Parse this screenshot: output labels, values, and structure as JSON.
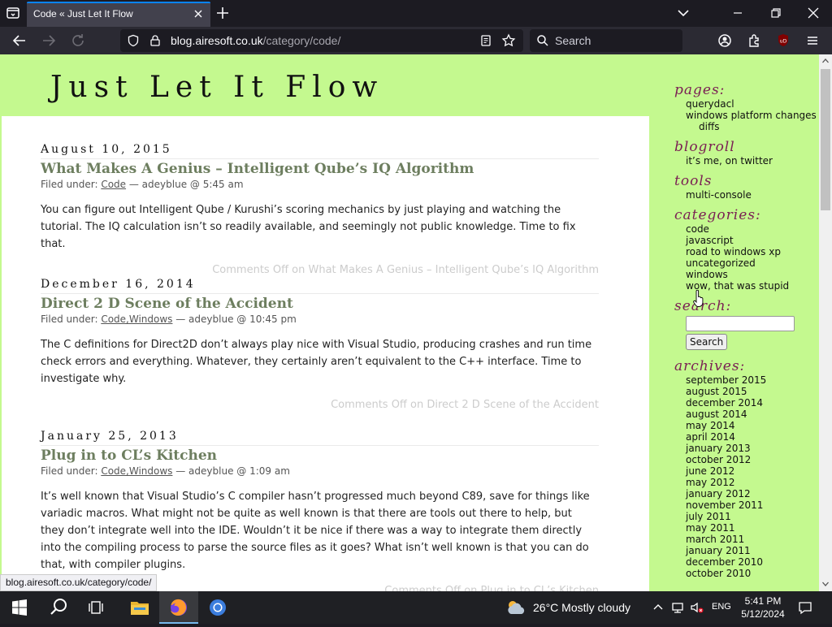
{
  "browser": {
    "tab_title": "Code « Just Let It Flow",
    "url_domain": "blog.airesoft.co.uk",
    "url_path": "/category/code/",
    "search_placeholder": "Search",
    "status_url": "blog.airesoft.co.uk/category/code/"
  },
  "site": {
    "title": "Just Let It Flow"
  },
  "posts": [
    {
      "date": "August 10, 2015",
      "title": "What Makes A Genius – Intelligent Qube’s IQ Algorithm",
      "filed_label": "Filed under: ",
      "categories": "Code",
      "byline": " — adeyblue @ 5:45 am",
      "body": "You can figure out Intelligent Qube / Kurushi’s scoring mechanics by just playing and watching the tutorial. The IQ calculation isn’t so readily available, and seemingly not public knowledge. Time to fix that.",
      "comments": "Comments Off on What Makes A Genius – Intelligent Qube’s IQ Algorithm"
    },
    {
      "date": "December 16, 2014",
      "title": "Direct 2 D Scene of the Accident",
      "filed_label": "Filed under: ",
      "categories": "Code,Windows",
      "byline": " — adeyblue @ 10:45 pm",
      "body": "The C definitions for Direct2D don’t always play nice with Visual Studio, producing crashes and run time check errors and everything. Whatever, they certainly aren’t equivalent to the C++ interface. Time to investigate why.",
      "comments": "Comments Off on Direct 2 D Scene of the Accident"
    },
    {
      "date": "January 25, 2013",
      "title": "Plug in to CL’s Kitchen",
      "filed_label": "Filed under: ",
      "categories": "Code,Windows",
      "byline": " — adeyblue @ 1:09 am",
      "body": "It’s well known that Visual Studio’s C compiler hasn’t progressed much beyond C89, save for things like variadic macros. What might not be quite as well known is that there are tools out there to help, but they don’t integrate well into the IDE. Wouldn’t it be nice if there was a way to integrate them directly into the compiling process to parse the source files as it goes? What isn’t well known is that you can do that, with compiler plugins.",
      "comments": "Comments Off on Plug in to CL’s Kitchen"
    }
  ],
  "sidebar": {
    "pages_heading": "pages:",
    "pages": [
      "querydacl",
      "windows platform changes",
      "diffs"
    ],
    "blogroll_heading": "blogroll",
    "blogroll": [
      "it’s me, on twitter"
    ],
    "tools_heading": "tools",
    "tools": [
      "multi-console"
    ],
    "categories_heading": "categories:",
    "categories": [
      "code",
      "javascript",
      "road to windows xp",
      "uncategorized",
      "windows",
      "wow, that was stupid"
    ],
    "search_heading": "search:",
    "search_button": "Search",
    "archives_heading": "archives:",
    "archives": [
      "september 2015",
      "august 2015",
      "december 2014",
      "august 2014",
      "may 2014",
      "april 2014",
      "january 2013",
      "october 2012",
      "june 2012",
      "may 2012",
      "january 2012",
      "november 2011",
      "july 2011",
      "may 2011",
      "march 2011",
      "january 2011",
      "december 2010",
      "october 2010"
    ]
  },
  "taskbar": {
    "weather": "26°C  Mostly cloudy",
    "language": "ENG",
    "time": "5:41 PM",
    "date": "5/12/2024"
  },
  "colors": {
    "page_bg": "#c4f98f",
    "heading_accent": "#7a1f53",
    "post_title": "#6d7e5f",
    "tab_accent": "#0a84ff"
  }
}
